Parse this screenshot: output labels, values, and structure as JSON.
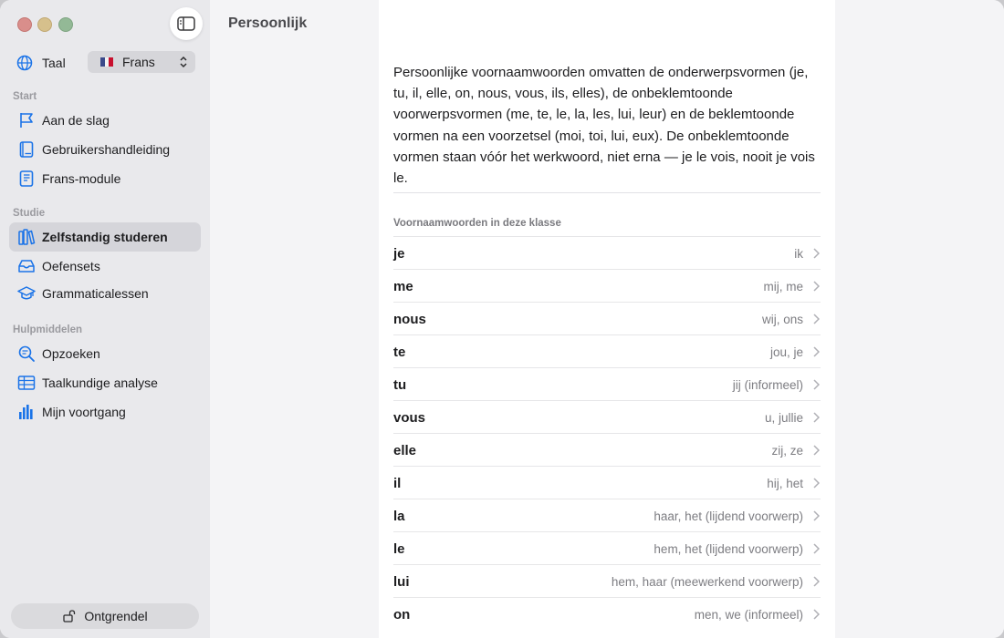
{
  "sidebar": {
    "language_label": "Taal",
    "language_value": "Frans",
    "sections": [
      {
        "title": "Start",
        "items": [
          {
            "label": "Aan de slag",
            "icon": "flag-icon"
          },
          {
            "label": "Gebruikershandleiding",
            "icon": "book-icon"
          },
          {
            "label": "Frans-module",
            "icon": "module-book-icon"
          }
        ]
      },
      {
        "title": "Studie",
        "items": [
          {
            "label": "Zelfstandig studeren",
            "icon": "books-icon",
            "active": true
          },
          {
            "label": "Oefensets",
            "icon": "tray-icon"
          },
          {
            "label": "Grammaticalessen",
            "icon": "graduation-cap-icon"
          }
        ]
      },
      {
        "title": "Hulpmiddelen",
        "items": [
          {
            "label": "Opzoeken",
            "icon": "magnifier-icon"
          },
          {
            "label": "Taalkundige analyse",
            "icon": "table-icon"
          },
          {
            "label": "Mijn voortgang",
            "icon": "bar-chart-icon"
          }
        ]
      }
    ],
    "unlock_label": "Ontgrendel"
  },
  "page": {
    "title": "Persoonlijk"
  },
  "content": {
    "intro": "Persoonlijke voornaamwoorden omvatten de onderwerpsvormen (je, tu, il, elle, on, nous, vous, ils, elles), de onbeklemtoonde voorwerpsvormen (me, te, le, la, les, lui, leur) en de beklemtoonde vormen na een voorzetsel (moi, toi, lui, eux). De onbeklemtoonde vormen staan vóór het werkwoord, niet erna — je le vois, nooit je vois le.",
    "list_header": "Voornaamwoorden in deze klasse",
    "rows": [
      {
        "term": "je",
        "translation": "ik"
      },
      {
        "term": "me",
        "translation": "mij, me"
      },
      {
        "term": "nous",
        "translation": "wij, ons"
      },
      {
        "term": "te",
        "translation": "jou, je"
      },
      {
        "term": "tu",
        "translation": "jij (informeel)"
      },
      {
        "term": "vous",
        "translation": "u, jullie"
      },
      {
        "term": "elle",
        "translation": "zij, ze"
      },
      {
        "term": "il",
        "translation": "hij, het"
      },
      {
        "term": "la",
        "translation": "haar, het (lijdend voorwerp)"
      },
      {
        "term": "le",
        "translation": "hem, het (lijdend voorwerp)"
      },
      {
        "term": "lui",
        "translation": "hem, haar (meewerkend voorwerp)"
      },
      {
        "term": "on",
        "translation": "men, we (informeel)"
      }
    ]
  },
  "colors": {
    "accent": "#1a73e8",
    "sidebar_bg": "#e9e9ec",
    "active_item_bg": "#d5d5da"
  }
}
